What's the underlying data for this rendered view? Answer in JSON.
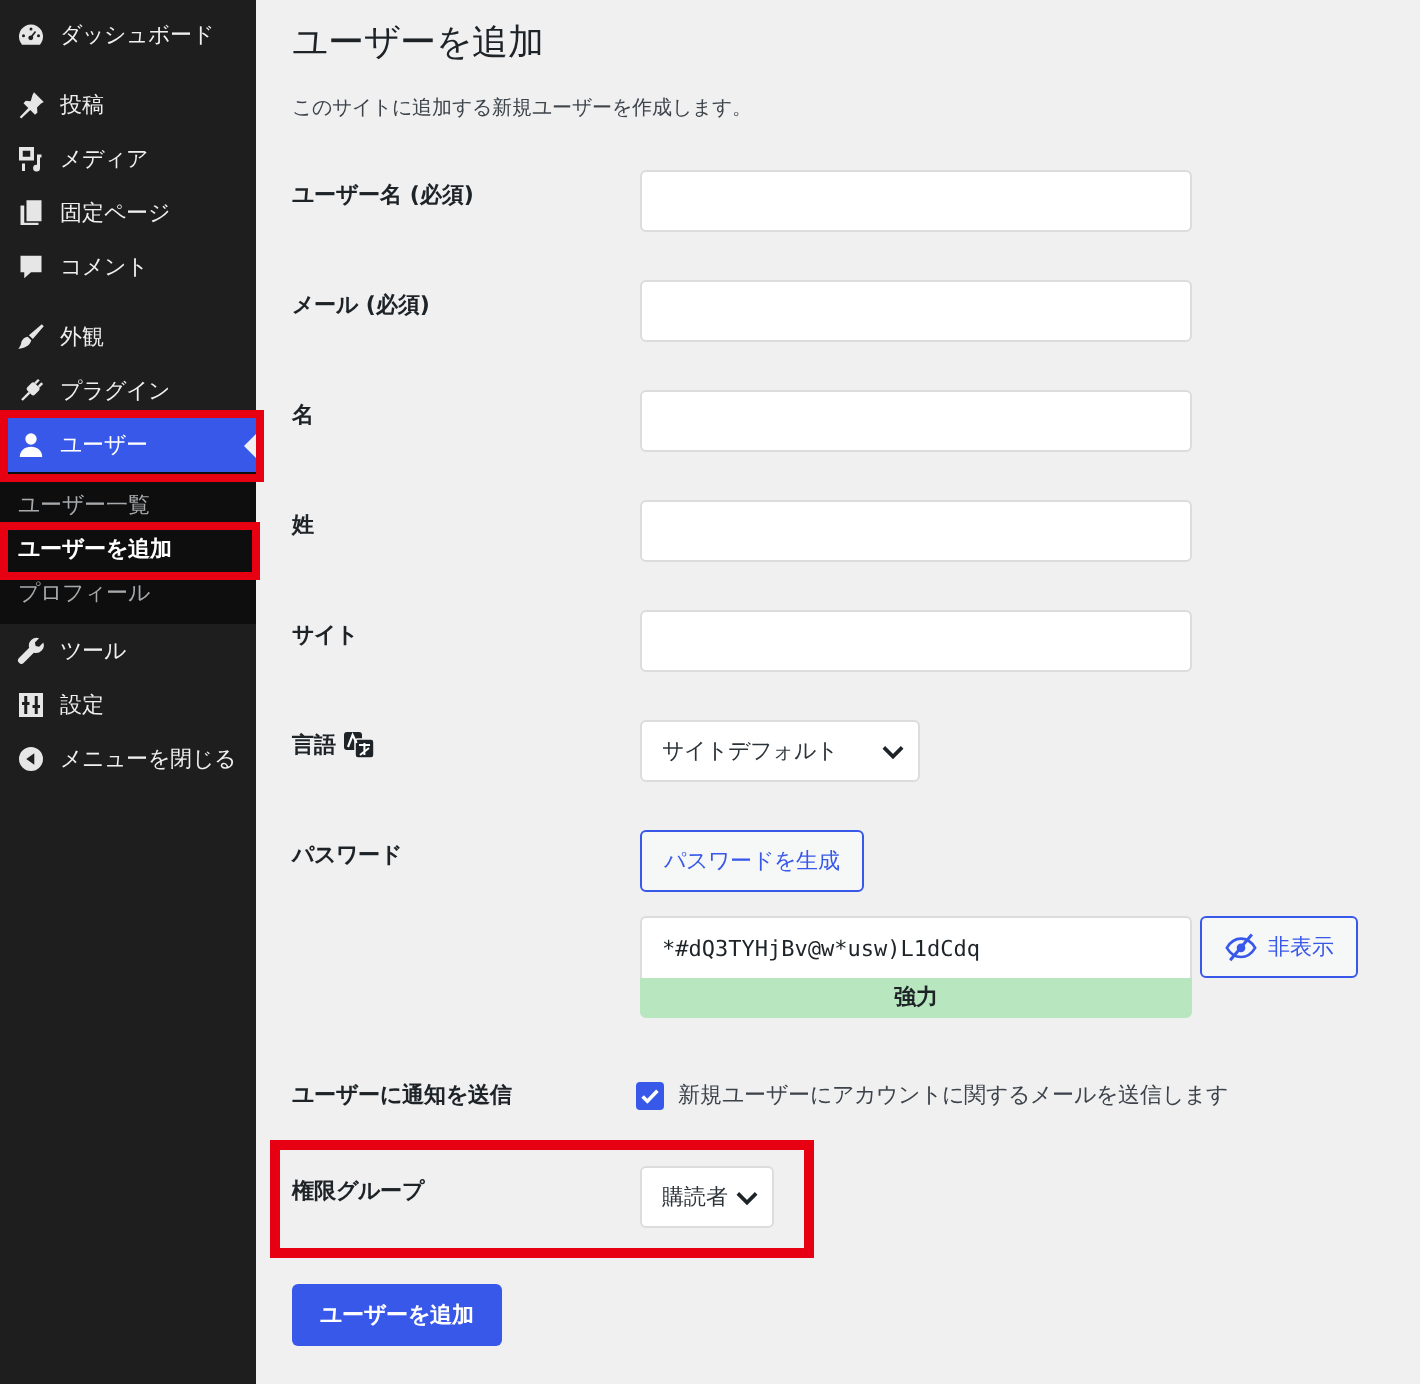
{
  "sidebar": {
    "groups": [
      {
        "items": [
          {
            "label": "ダッシュボード",
            "selected": false,
            "annotated": false
          }
        ]
      },
      {
        "items": [
          {
            "label": "投稿",
            "selected": false,
            "annotated": false
          },
          {
            "label": "メディア",
            "selected": false,
            "annotated": false
          },
          {
            "label": "固定ページ",
            "selected": false,
            "annotated": false
          },
          {
            "label": "コメント",
            "selected": false,
            "annotated": false
          }
        ]
      },
      {
        "items": [
          {
            "label": "外観",
            "selected": false,
            "annotated": false
          },
          {
            "label": "プラグイン",
            "selected": false,
            "annotated": false
          },
          {
            "label": "ユーザー",
            "selected": true,
            "annotated": true,
            "submenu": [
              {
                "label": "ユーザー一覧",
                "selected": false,
                "annotated": false
              },
              {
                "label": "ユーザーを追加",
                "selected": true,
                "annotated": true
              },
              {
                "label": "プロフィール",
                "selected": false,
                "annotated": false
              }
            ]
          },
          {
            "label": "ツール",
            "selected": false,
            "annotated": false
          },
          {
            "label": "設定",
            "selected": false,
            "annotated": false
          }
        ]
      }
    ],
    "collapse": {
      "label": "メニューを閉じる"
    }
  },
  "main": {
    "title": "ユーザーを追加",
    "description": "このサイトに追加する新規ユーザーを作成します。",
    "form": {
      "rows": [
        {
          "kind": "text",
          "label": "ユーザー名 (必須)",
          "annotated": false
        },
        {
          "kind": "text",
          "label": "メール (必須)",
          "annotated": false
        },
        {
          "kind": "text",
          "label": "名",
          "annotated": false
        },
        {
          "kind": "text",
          "label": "姓",
          "annotated": false
        },
        {
          "kind": "text",
          "label": "サイト",
          "annotated": false
        },
        {
          "kind": "select",
          "label": "言語",
          "label_icon": true,
          "value": "サイトデフォルト",
          "annotated": false
        },
        {
          "kind": "password",
          "label": "パスワード",
          "generate_button": "パスワードを生成",
          "value": "*#dQ3TYHjBv@w*usw)L1dCdq",
          "strength": "強力",
          "toggle_button": "非表示",
          "annotated": false
        },
        {
          "kind": "checkbox",
          "label": "ユーザーに通知を送信",
          "checked": true,
          "text": "新規ユーザーにアカウントに関するメールを送信します",
          "annotated": false
        },
        {
          "kind": "select",
          "label": "権限グループ",
          "value": "購読者",
          "annotated": true
        }
      ]
    },
    "submit_button": "ユーザーを追加"
  }
}
